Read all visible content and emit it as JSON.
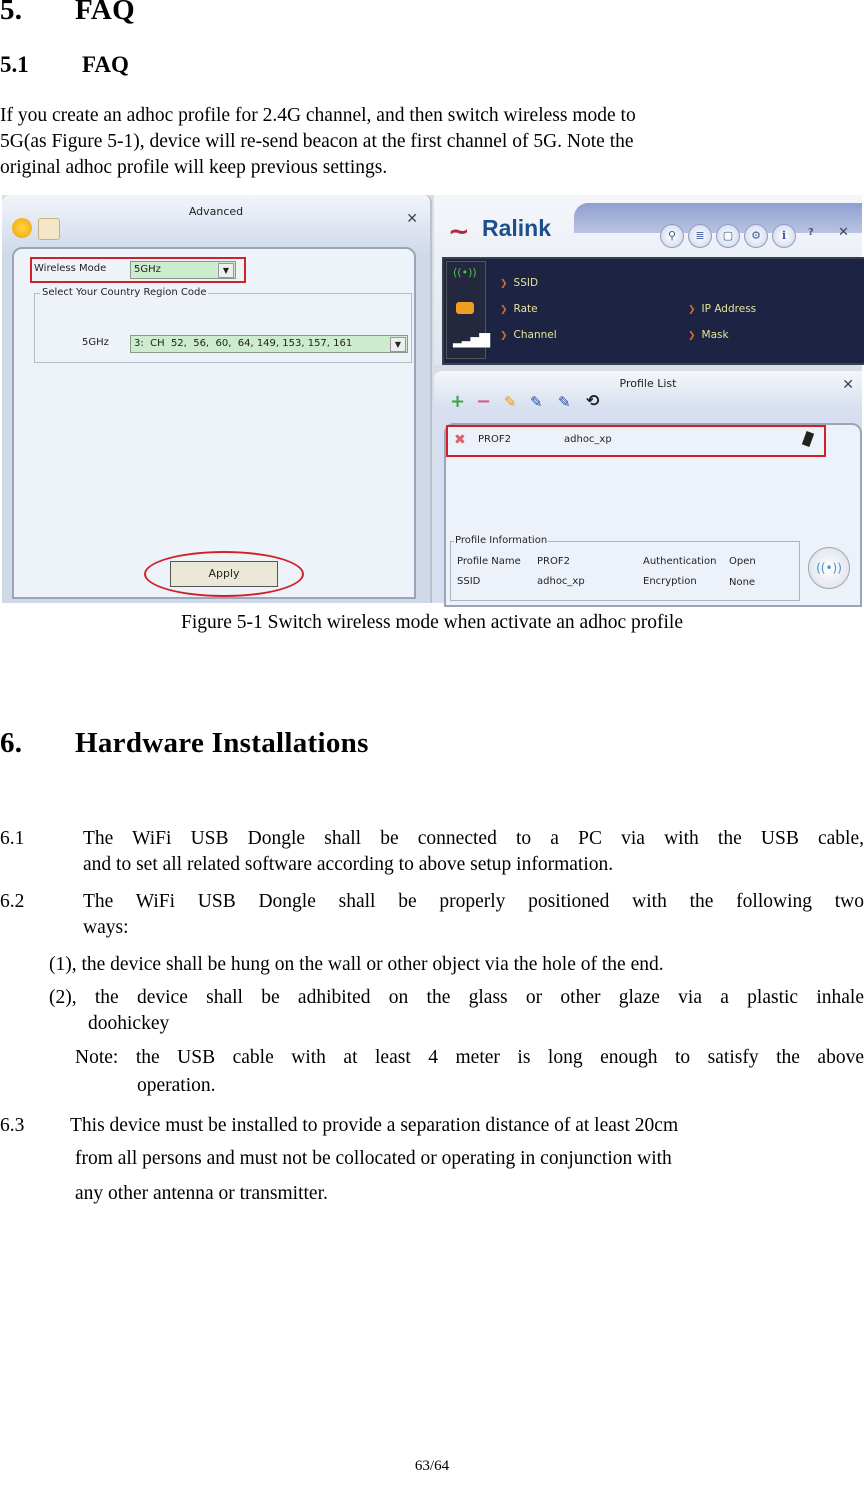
{
  "section5": {
    "number": "5.",
    "title": "FAQ"
  },
  "section51": {
    "number": "5.1",
    "title": "FAQ"
  },
  "intro_lines": [
    "If you create an adhoc profile for 2.4G channel, and then switch wireless mode to",
    "5G(as Figure 5-1), device will re-send beacon at the first channel of 5G. Note the",
    "original adhoc profile will keep previous settings."
  ],
  "figure": {
    "caption": "Figure 5-1 Switch wireless mode when activate an adhoc profile",
    "advanced": {
      "title": "Advanced",
      "close": "✕",
      "wireless_mode_label": "Wireless Mode",
      "wireless_mode_value": "5GHz",
      "region_group_label": "Select Your Country Region Code",
      "region_band_label": "5GHz",
      "region_value": "3:  CH  52,  56,  60,  64, 149, 153, 157, 161",
      "apply_label": "Apply",
      "dropdown_glyph": "▼"
    },
    "ralink": {
      "logo": "Ralink",
      "toolbar": [
        "⚲",
        "≣",
        "▢",
        "⚙",
        "i"
      ],
      "help": "?",
      "close": "✕",
      "items_left": [
        "SSID",
        "Rate",
        "Channel"
      ],
      "items_right": [
        "IP Address",
        "Mask"
      ],
      "bullet": "❯"
    },
    "profile_list": {
      "title": "Profile List",
      "close": "✕",
      "toolbar": [
        "+",
        "−",
        "✎",
        "✎",
        "✎",
        "⟲"
      ],
      "row": {
        "status_icon": "✖",
        "profile": "PROF2",
        "ssid": "adhoc_xp"
      },
      "info_group_label": "Profile Information",
      "info": {
        "profile_name_label": "Profile Name",
        "profile_name": "PROF2",
        "ssid_label": "SSID",
        "ssid": "adhoc_xp",
        "auth_label": "Authentication",
        "auth": "Open",
        "enc_label": "Encryption",
        "enc": "None"
      }
    }
  },
  "section6": {
    "number": "6.",
    "title": "Hardware Installations"
  },
  "items": {
    "i61": {
      "number": "6.1",
      "line1": "The WiFi USB Dongle shall be connected to a PC via with the USB cable,",
      "line2": "and to set all related software according to above setup information."
    },
    "i62": {
      "number": "6.2",
      "line1": "The WiFi USB Dongle shall be properly positioned with the following two",
      "line2": "ways:"
    },
    "sub1": "(1), the device shall be hung on the wall or other object via the hole of the end.",
    "sub2_line1": "(2), the device shall be adhibited on the glass or other glaze via a plastic inhale",
    "sub2_line2": "doohickey",
    "note_line1": "Note: the USB cable with at least 4 meter is long enough to satisfy the above",
    "note_line2": "operation.",
    "i63": {
      "number": "6.3",
      "line1": "This device must be installed to provide a separation distance of at least 20cm",
      "line2": "from all persons and must not be collocated or operating in conjunction with",
      "line3": "any other antenna or transmitter."
    }
  },
  "page_number": "63/64",
  "colors": {
    "highlight_red": "#d0202a",
    "ralink_dark": "#1d2342",
    "ralink_text": "#e5e59a",
    "select_green": "#cdeccd"
  }
}
